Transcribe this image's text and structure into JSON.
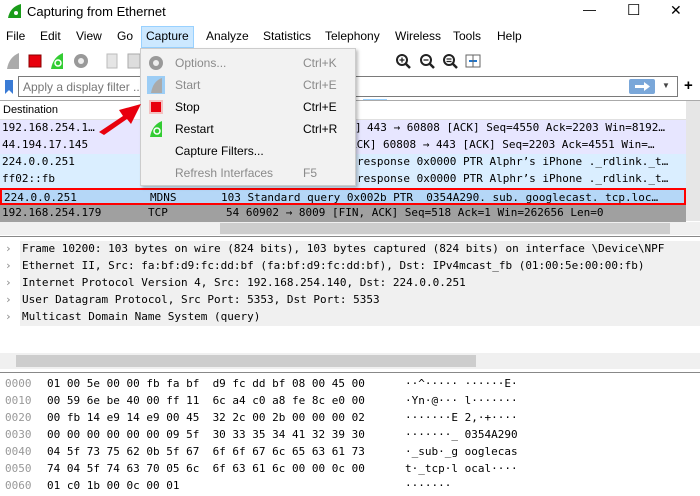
{
  "window": {
    "title": "Capturing from Ethernet",
    "minimize": "—",
    "maximize": "☐",
    "close": "✕"
  },
  "menubar": [
    "File",
    "Edit",
    "View",
    "Go",
    "Capture",
    "Analyze",
    "Statistics",
    "Telephony",
    "Wireless",
    "Tools",
    "Help"
  ],
  "filter": {
    "placeholder": "Apply a display filter ... <Ctrl-/>",
    "plus": "+"
  },
  "capture_menu": [
    {
      "label": "Options...",
      "shortcut": "Ctrl+K",
      "enabled": false,
      "icon": "gear-icon"
    },
    {
      "label": "Start",
      "shortcut": "Ctrl+E",
      "enabled": false,
      "icon": "shark-fin-icon"
    },
    {
      "label": "Stop",
      "shortcut": "Ctrl+E",
      "enabled": true,
      "icon": "stop-icon"
    },
    {
      "label": "Restart",
      "shortcut": "Ctrl+R",
      "enabled": true,
      "icon": "restart-icon"
    },
    {
      "label": "Capture Filters...",
      "shortcut": "",
      "enabled": true,
      "icon": ""
    },
    {
      "label": "Refresh Interfaces",
      "shortcut": "F5",
      "enabled": false,
      "icon": ""
    }
  ],
  "packet_list": {
    "header": {
      "destination": "Destination"
    },
    "rows": [
      {
        "destination": "192.168.254.1…",
        "protocol": "",
        "info": "443 → 60808 [ACK] Seq=4550 Ack=2203 Win=8192…",
        "info_prefix": "]",
        "color": "#e7e6ff"
      },
      {
        "destination": "44.194.17.145",
        "protocol": "",
        "info": "60808 → 443 [ACK] Seq=2203 Ack=4551 Win=…",
        "info_prefix": "ACK]",
        "color": "#e7e6ff"
      },
      {
        "destination": "224.0.0.251",
        "protocol": "",
        "info": "response 0x0000 PTR Alphr’s iPhone ._rdlink._t…",
        "info_prefix": "",
        "color": "#daeeff"
      },
      {
        "destination": "ff02::fb",
        "protocol": "",
        "info": "response 0x0000 PTR Alphr’s iPhone ._rdlink._t…",
        "info_prefix": "",
        "color": "#daeeff"
      },
      {
        "destination": "224.0.0.251",
        "protocol": "MDNS",
        "info": "103 Standard query 0x002b PTR _0354A290._sub._googlecast._tcp.loc…",
        "info_prefix": "",
        "color": "#b5d7f7"
      },
      {
        "destination": "192.168.254.179",
        "protocol": "TCP",
        "info": "54 60902 → 8009 [FIN, ACK] Seq=518 Ack=1 Win=262656 Len=0",
        "info_prefix": "",
        "color": "#a0a0a0"
      }
    ]
  },
  "details": [
    "Frame 10200: 103 bytes on wire (824 bits), 103 bytes captured (824 bits) on interface \\Device\\NPF",
    "Ethernet II, Src: fa:bf:d9:fc:dd:bf (fa:bf:d9:fc:dd:bf), Dst: IPv4mcast_fb (01:00:5e:00:00:fb)",
    "Internet Protocol Version 4, Src: 192.168.254.140, Dst: 224.0.0.251",
    "User Datagram Protocol, Src Port: 5353, Dst Port: 5353",
    "Multicast Domain Name System (query)"
  ],
  "hex": [
    {
      "offset": "0000",
      "bytes": "01 00 5e 00 00 fb fa bf  d9 fc dd bf 08 00 45 00",
      "ascii": "··^····· ······E·"
    },
    {
      "offset": "0010",
      "bytes": "00 59 6e be 40 00 ff 11  6c a4 c0 a8 fe 8c e0 00",
      "ascii": "·Yn·@··· l·······"
    },
    {
      "offset": "0020",
      "bytes": "00 fb 14 e9 14 e9 00 45  32 2c 00 2b 00 00 00 02",
      "ascii": "·······E 2,·+····"
    },
    {
      "offset": "0030",
      "bytes": "00 00 00 00 00 00 09 5f  30 33 35 34 41 32 39 30",
      "ascii": "·······_ 0354A290"
    },
    {
      "offset": "0040",
      "bytes": "04 5f 73 75 62 0b 5f 67  6f 6f 67 6c 65 63 61 73",
      "ascii": "·_sub·_g ooglecas"
    },
    {
      "offset": "0050",
      "bytes": "74 04 5f 74 63 70 05 6c  6f 63 61 6c 00 00 0c 00",
      "ascii": "t·_tcp·l ocal····"
    },
    {
      "offset": "0060",
      "bytes": "01 c0 1b 00 0c 00 01",
      "ascii": "·······"
    }
  ],
  "colors": {
    "accent_red": "#e8000d",
    "menu_highlight": "#cce8ff",
    "selected_border": "#ff0000"
  }
}
